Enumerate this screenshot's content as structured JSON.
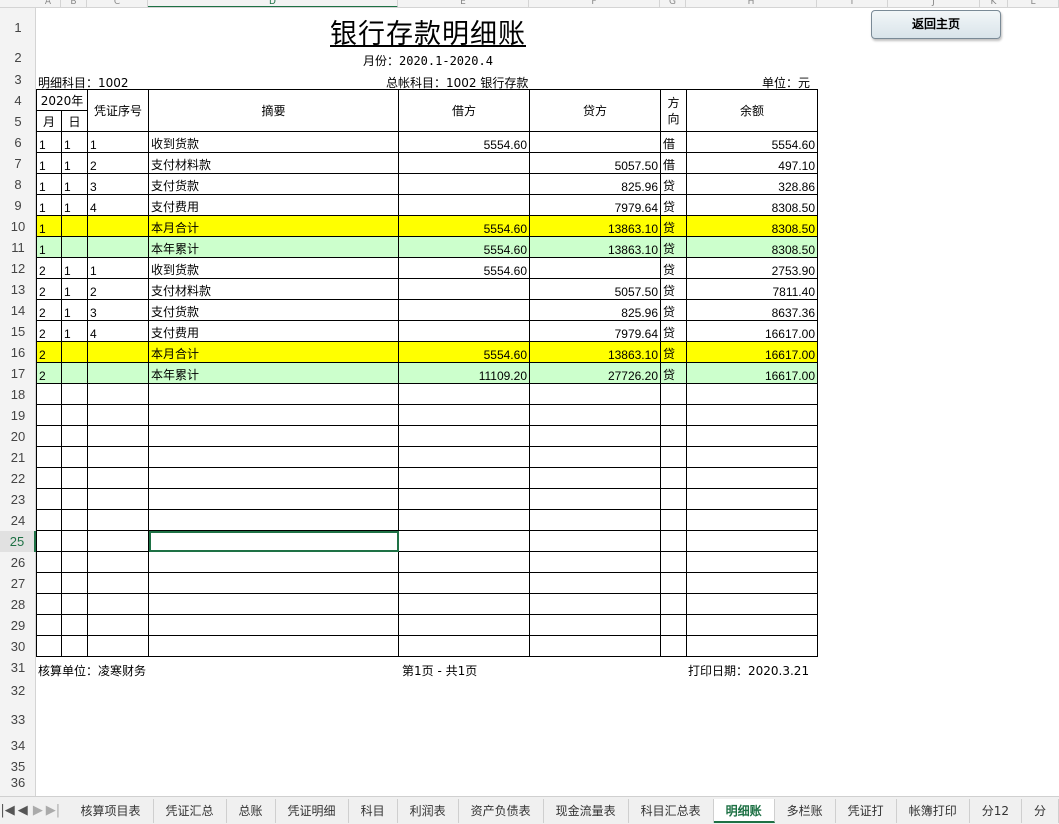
{
  "columns": [
    "A",
    "B",
    "C",
    "D",
    "E",
    "F",
    "G",
    "H",
    "I",
    "J",
    "K",
    "L"
  ],
  "rows": [
    "1",
    "2",
    "3",
    "4",
    "5",
    "6",
    "7",
    "8",
    "9",
    "10",
    "11",
    "12",
    "13",
    "14",
    "15",
    "16",
    "17",
    "18",
    "19",
    "20",
    "21",
    "22",
    "23",
    "24",
    "25",
    "26",
    "27",
    "28",
    "29",
    "30",
    "31",
    "32",
    "33",
    "34",
    "35",
    "36"
  ],
  "title": "银行存款明细账",
  "month": "月份：2020.1-2020.4",
  "home_button": "返回主页",
  "info": {
    "detail_account": "明细科目：1002",
    "general_account": "总帐科目：1002  银行存款",
    "unit": "单位：元"
  },
  "headers": {
    "year": "2020年",
    "month": "月",
    "day": "日",
    "voucher": "凭证序号",
    "summary": "摘要",
    "debit": "借方",
    "credit": "贷方",
    "direction": "方向",
    "balance": "余额"
  },
  "entries": [
    {
      "m": "1",
      "d": "1",
      "v": "1",
      "s": "收到货款",
      "dr": "5554.60",
      "cr": "",
      "dir": "借",
      "bal": "5554.60",
      "style": ""
    },
    {
      "m": "1",
      "d": "1",
      "v": "2",
      "s": "支付材料款",
      "dr": "",
      "cr": "5057.50",
      "dir": "借",
      "bal": "497.10",
      "style": ""
    },
    {
      "m": "1",
      "d": "1",
      "v": "3",
      "s": "支付货款",
      "dr": "",
      "cr": "825.96",
      "dir": "贷",
      "bal": "328.86",
      "style": ""
    },
    {
      "m": "1",
      "d": "1",
      "v": "4",
      "s": "支付费用",
      "dr": "",
      "cr": "7979.64",
      "dir": "贷",
      "bal": "8308.50",
      "style": ""
    },
    {
      "m": "1",
      "d": "",
      "v": "",
      "s": "本月合计",
      "dr": "5554.60",
      "cr": "13863.10",
      "dir": "贷",
      "bal": "8308.50",
      "style": "yellow"
    },
    {
      "m": "1",
      "d": "",
      "v": "",
      "s": "本年累计",
      "dr": "5554.60",
      "cr": "13863.10",
      "dir": "贷",
      "bal": "8308.50",
      "style": "green"
    },
    {
      "m": "2",
      "d": "1",
      "v": "1",
      "s": "收到货款",
      "dr": "5554.60",
      "cr": "",
      "dir": "贷",
      "bal": "2753.90",
      "style": ""
    },
    {
      "m": "2",
      "d": "1",
      "v": "2",
      "s": "支付材料款",
      "dr": "",
      "cr": "5057.50",
      "dir": "贷",
      "bal": "7811.40",
      "style": ""
    },
    {
      "m": "2",
      "d": "1",
      "v": "3",
      "s": "支付货款",
      "dr": "",
      "cr": "825.96",
      "dir": "贷",
      "bal": "8637.36",
      "style": ""
    },
    {
      "m": "2",
      "d": "1",
      "v": "4",
      "s": "支付费用",
      "dr": "",
      "cr": "7979.64",
      "dir": "贷",
      "bal": "16617.00",
      "style": ""
    },
    {
      "m": "2",
      "d": "",
      "v": "",
      "s": "本月合计",
      "dr": "5554.60",
      "cr": "13863.10",
      "dir": "贷",
      "bal": "16617.00",
      "style": "yellow"
    },
    {
      "m": "2",
      "d": "",
      "v": "",
      "s": "本年累计",
      "dr": "11109.20",
      "cr": "27726.20",
      "dir": "贷",
      "bal": "16617.00",
      "style": "green"
    }
  ],
  "footer": {
    "unit": "核算单位：凌寒财务",
    "page": "第1页 - 共1页",
    "print_date": "打印日期：2020.3.21"
  },
  "tabs": [
    "核算项目表",
    "凭证汇总",
    "总账",
    "凭证明细",
    "科目",
    "利润表",
    "资产负债表",
    "现金流量表",
    "科目汇总表",
    "明细账",
    "多栏账",
    "凭证打",
    "帐簿打印",
    "分12",
    "分"
  ],
  "active_tab": "明细账",
  "colors": {
    "month_total": "#ffff00",
    "year_total": "#ccffcc",
    "accent": "#1e7145"
  }
}
